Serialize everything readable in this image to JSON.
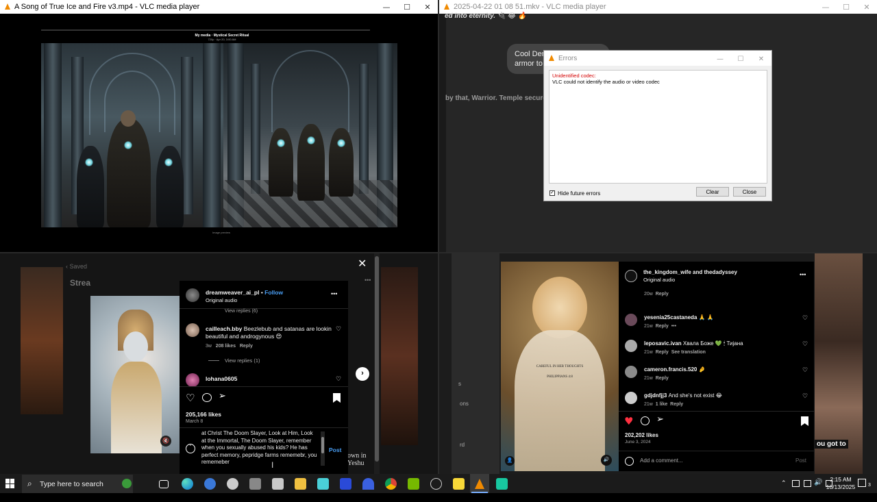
{
  "top_left_window": {
    "title": "A Song of True Ice and Fire v3.mp4 - VLC media player",
    "video_header": "My media · Mystical Secret Ritual",
    "video_subheader": "720p · Apr 20, 3:00 AM",
    "video_footer": "Image preview"
  },
  "top_right_window": {
    "title": "2025-04-22 01 08 51.mkv - VLC media player",
    "chat_line_1": "ed into eternity. 🔌 😂 🔥",
    "chat_bubble": "Cool Dem",
    "chat_bubble_2": "armor to",
    "chat_line_2": "by that, Warrior. Temple secure"
  },
  "error_dialog": {
    "title": "Errors",
    "error_heading": "Unidentified codec:",
    "error_message": "VLC could not identify the audio or video codec",
    "checkbox_label": "Hide future errors",
    "checkbox_checked": true,
    "clear_label": "Clear",
    "close_label": "Close"
  },
  "ig_left": {
    "back_label": "Saved",
    "partial_heading": "Strea",
    "username": "dreamweaver_ai_pl",
    "follow_label": "Follow",
    "audio": "Original audio",
    "view_replies_top": "View replies (6)",
    "comment_user": "cailleach.bby",
    "comment_text": "Beezlebub and satanas are lookin beautiful and androgynous 😍",
    "comment_time": "3w",
    "comment_likes": "208 likes",
    "reply_label": "Reply",
    "view_replies_2": "View replies (1)",
    "next_user": "lohana0605",
    "likes": "205,166 likes",
    "date": "March 8",
    "draft_text": "at Christ The Doom Slayer, Look at Him, Look at the Immortal, The Doom Slayer, remember when you sexually abused his kids? He has perfect memory, pepridge farms rememebr, you rememeber",
    "post_label": "Post",
    "bg_text_1": "own in",
    "bg_text_2": "Yeshu"
  },
  "ig_right": {
    "username": "the_kingdom_wife and thedadyssey",
    "audio": "Original audio",
    "first_meta": "20w",
    "reply_label": "Reply",
    "comments": [
      {
        "user": "yesenia25castaneda",
        "text": "🙏 🙏",
        "time": "21w",
        "extra": ""
      },
      {
        "user": "leposavic.ivan",
        "text": "Хвала Боже 💚 🕯 Тијана",
        "time": "21w",
        "extra": "See translation"
      },
      {
        "user": "cameron.francis.520",
        "text": "🤌",
        "time": "21w",
        "extra": ""
      },
      {
        "user": "gdjdnfjj3",
        "text": "And she's not exist 😂",
        "time": "21w",
        "likes": "1 like",
        "extra": ""
      }
    ],
    "likes": "202,202 likes",
    "date": "June 3, 2024",
    "comment_placeholder": "Add a comment...",
    "post_label": "Post",
    "image_caption_1": "CAREFUL IN HER THOUGHTS",
    "image_caption_2": "PHILIPPIANS 4:8",
    "bg_left_1": "s",
    "bg_left_2": "ons",
    "bg_left_3": "rd",
    "bg_right": "ou got to"
  },
  "taskbar": {
    "search_placeholder": "Type here to search",
    "time": "2:15 AM",
    "date": "10/13/2025",
    "notification_count": "3"
  },
  "colors": {
    "ig_blue": "#4a9ff5",
    "ig_red": "#ff3040",
    "vlc_orange": "#f08a00",
    "error_red": "#d40000"
  }
}
